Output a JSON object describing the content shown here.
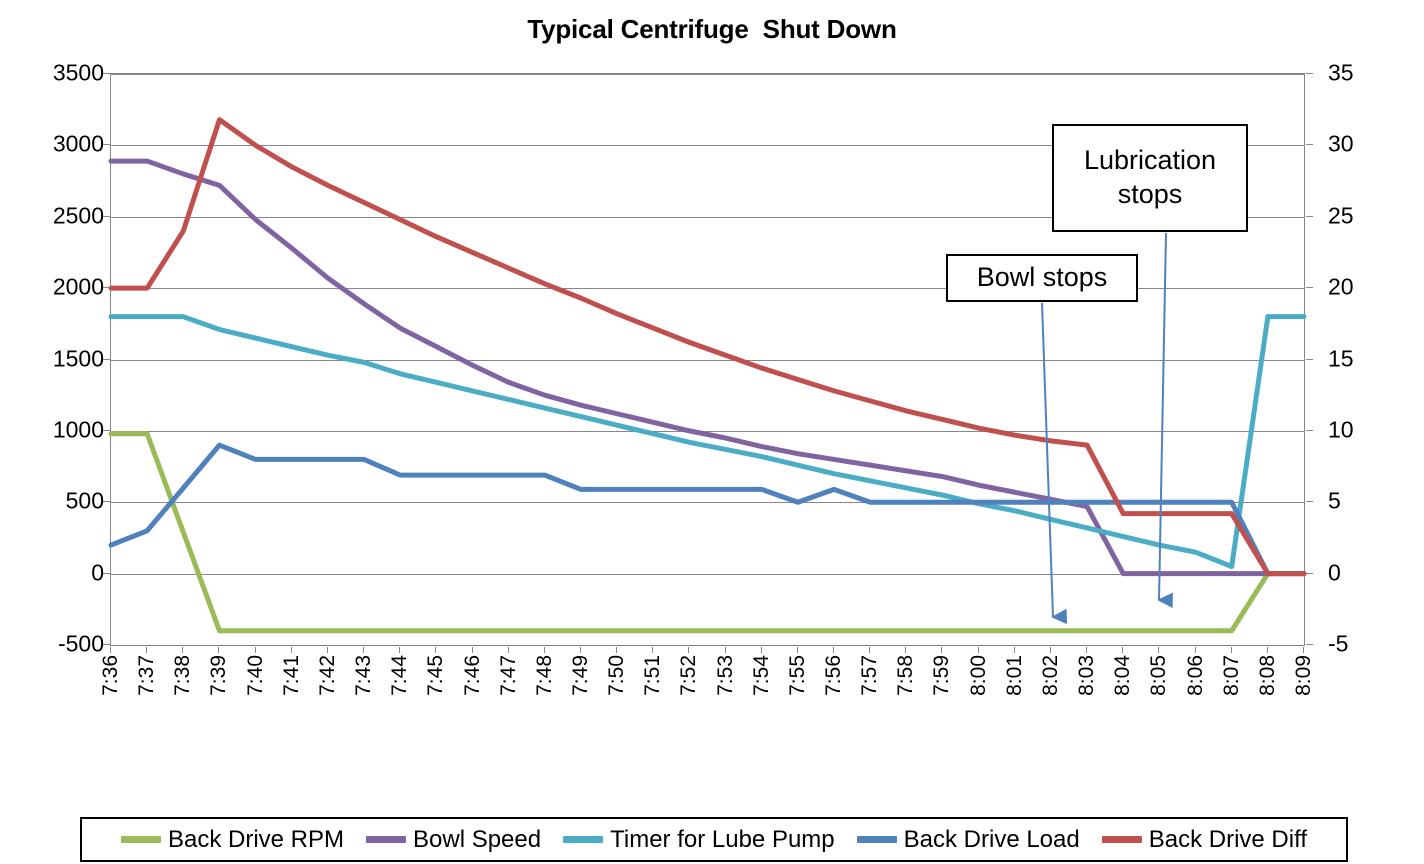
{
  "chart_data": {
    "type": "line",
    "title": "Typical Centrifuge  Shut Down",
    "xlabel": "",
    "ylabel": "",
    "y2label": "",
    "grid": true,
    "legend_position": "bottom",
    "ylim": [
      -500,
      3500
    ],
    "ytick_step": 500,
    "y2lim": [
      -5,
      35
    ],
    "y2tick_step": 5,
    "yticks": [
      "3500",
      "3000",
      "2500",
      "2000",
      "1500",
      "1000",
      "500",
      "0",
      "-500"
    ],
    "y2ticks": [
      "35",
      "30",
      "25",
      "20",
      "15",
      "10",
      "5",
      "0",
      "-5"
    ],
    "categories": [
      "7:36",
      "7:37",
      "7:38",
      "7:39",
      "7:40",
      "7:41",
      "7:42",
      "7:43",
      "7:44",
      "7:45",
      "7:46",
      "7:47",
      "7:48",
      "7:49",
      "7:50",
      "7:51",
      "7:52",
      "7:53",
      "7:54",
      "7:55",
      "7:56",
      "7:57",
      "7:58",
      "7:59",
      "8:00",
      "8:01",
      "8:02",
      "8:03",
      "8:04",
      "8:05",
      "8:06",
      "8:07",
      "8:08",
      "8:09"
    ],
    "series": [
      {
        "name": "Back Drive RPM",
        "color": "#9BBB59",
        "axis": "left",
        "values": [
          980,
          980,
          290,
          -400,
          -400,
          -400,
          -400,
          -400,
          -400,
          -400,
          -400,
          -400,
          -400,
          -400,
          -400,
          -400,
          -400,
          -400,
          -400,
          -400,
          -400,
          -400,
          -400,
          -400,
          -400,
          -400,
          -400,
          -400,
          -400,
          -400,
          -400,
          -400,
          0,
          0
        ]
      },
      {
        "name": "Bowl Speed",
        "color": "#8064A2",
        "axis": "left",
        "values": [
          2890,
          2890,
          2800,
          2720,
          2480,
          2280,
          2070,
          1890,
          1720,
          1590,
          1460,
          1340,
          1250,
          1180,
          1120,
          1060,
          1000,
          950,
          890,
          840,
          800,
          760,
          720,
          680,
          620,
          570,
          520,
          470,
          0,
          0,
          0,
          0,
          0,
          0
        ]
      },
      {
        "name": "Timer for Lube Pump",
        "color": "#4BACC6",
        "axis": "left",
        "values": [
          1800,
          1800,
          1800,
          1710,
          1650,
          1590,
          1530,
          1480,
          1400,
          1340,
          1280,
          1220,
          1160,
          1100,
          1040,
          980,
          920,
          870,
          820,
          760,
          700,
          650,
          600,
          550,
          490,
          440,
          380,
          320,
          260,
          200,
          150,
          50,
          1800,
          1800
        ]
      },
      {
        "name": "Back Drive Load",
        "color": "#4F81BD",
        "axis": "right",
        "values": [
          2,
          3,
          6,
          9,
          8,
          8,
          8,
          8,
          6.9,
          6.9,
          6.9,
          6.9,
          6.9,
          5.9,
          5.9,
          5.9,
          5.9,
          5.9,
          5.9,
          5,
          5.9,
          5,
          5,
          5,
          5,
          5,
          5,
          5,
          5,
          5,
          5,
          5,
          0,
          0
        ]
      },
      {
        "name": "Back Drive Diff",
        "color": "#C0504D",
        "axis": "right",
        "values": [
          20,
          20,
          24,
          31.8,
          30,
          28.5,
          27.2,
          26,
          24.8,
          23.6,
          22.5,
          21.4,
          20.3,
          19.3,
          18.2,
          17.2,
          16.2,
          15.3,
          14.4,
          13.6,
          12.8,
          12.1,
          11.4,
          10.8,
          10.2,
          9.7,
          9.3,
          9,
          4.2,
          4.2,
          4.2,
          4.2,
          0,
          0
        ]
      }
    ],
    "annotations": [
      {
        "id": "lubrication",
        "text": "Lubrication\nstops",
        "arrow_color": "#4F81BD",
        "target_category": "8:06"
      },
      {
        "id": "bowl",
        "text": "Bowl stops",
        "arrow_color": "#4F81BD",
        "target_category": "8:03"
      }
    ]
  },
  "annotation_text": {
    "lubrication_line1": "Lubrication",
    "lubrication_line2": "stops",
    "bowl": "Bowl stops"
  }
}
